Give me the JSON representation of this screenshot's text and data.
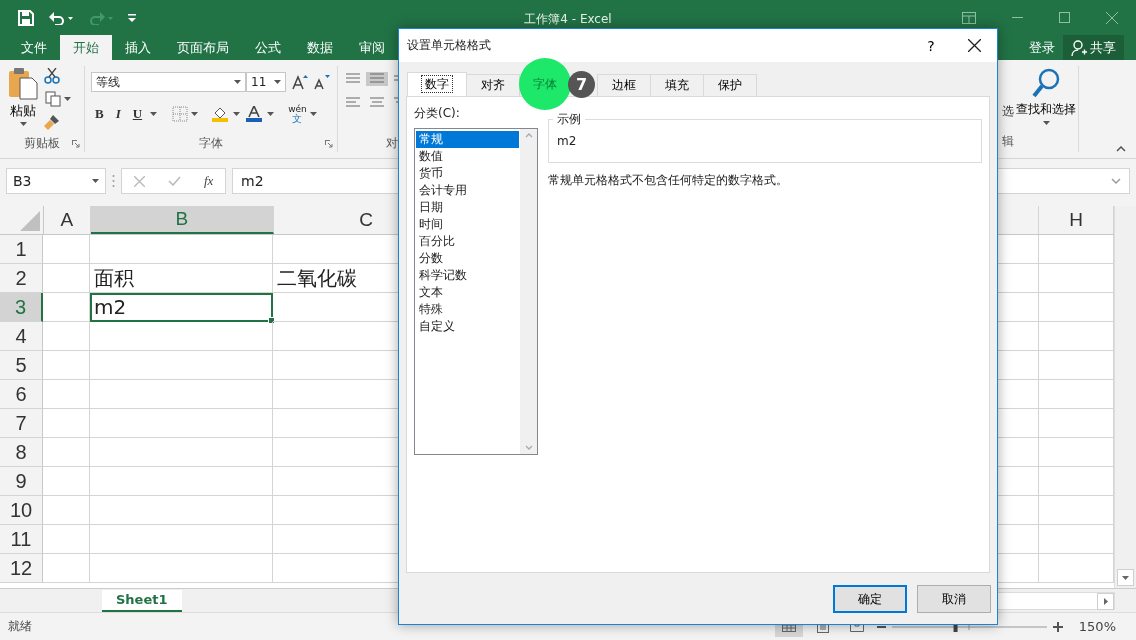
{
  "window": {
    "title": "工作簿4 - Excel"
  },
  "ribbon_tabs": [
    {
      "label": "文件",
      "selected": false
    },
    {
      "label": "开始",
      "selected": true
    },
    {
      "label": "插入",
      "selected": false
    },
    {
      "label": "页面布局",
      "selected": false
    },
    {
      "label": "公式",
      "selected": false
    },
    {
      "label": "数据",
      "selected": false
    },
    {
      "label": "审阅",
      "selected": false
    }
  ],
  "account": {
    "sign_in": "登录",
    "share": "共享"
  },
  "ribbon": {
    "paste": "粘贴",
    "clipboard_group": "剪贴板",
    "font_name": "等线",
    "font_size": "11",
    "phonetic": "wén",
    "phonetic_char": "文",
    "bold": "B",
    "italic": "I",
    "underline": "U",
    "font_group": "字体",
    "alignment_group_partial": "对",
    "sort_partial": "选",
    "find_select": "查找和选择",
    "editing_group_partial": "辑"
  },
  "formula_bar": {
    "name_box": "B3",
    "fx": "fx",
    "value": "m2"
  },
  "grid": {
    "columns": [
      {
        "label": "A",
        "selected": false
      },
      {
        "label": "B",
        "selected": true
      },
      {
        "label": "C",
        "selected": false
      },
      {
        "label": "H",
        "selected": false
      }
    ],
    "rows": [
      {
        "header": "1",
        "selected": false
      },
      {
        "header": "2",
        "selected": false,
        "column_b": "面积",
        "column_c": "二氧化碳"
      },
      {
        "header": "3",
        "selected": true,
        "column_b": "m2"
      },
      {
        "header": "4",
        "selected": false
      },
      {
        "header": "5",
        "selected": false
      },
      {
        "header": "6",
        "selected": false
      },
      {
        "header": "7",
        "selected": false
      },
      {
        "header": "8",
        "selected": false
      },
      {
        "header": "9",
        "selected": false
      },
      {
        "header": "10",
        "selected": false
      },
      {
        "header": "11",
        "selected": false
      },
      {
        "header": "12",
        "selected": false
      }
    ]
  },
  "sheet_tabs": [
    {
      "label": "Sheet1",
      "selected": true
    }
  ],
  "status_bar": {
    "status": "就绪",
    "zoom": "150%",
    "zoom_slider": {
      "level": 0.41
    }
  },
  "dialog": {
    "title": "设置单元格格式",
    "help": "?",
    "tabs": [
      {
        "label": "数字",
        "selected": true,
        "highlighted": false
      },
      {
        "label": "对齐",
        "selected": false,
        "highlighted": false
      },
      {
        "label": "字体",
        "selected": false,
        "highlighted": true
      },
      {
        "label": "边框",
        "selected": false,
        "highlighted": false
      },
      {
        "label": "填充",
        "selected": false,
        "highlighted": false
      },
      {
        "label": "保护",
        "selected": false,
        "highlighted": false
      }
    ],
    "category_label": "分类(C):",
    "categories": [
      {
        "label": "常规",
        "selected": true
      },
      {
        "label": "数值",
        "selected": false
      },
      {
        "label": "货币",
        "selected": false
      },
      {
        "label": "会计专用",
        "selected": false
      },
      {
        "label": "日期",
        "selected": false
      },
      {
        "label": "时间",
        "selected": false
      },
      {
        "label": "百分比",
        "selected": false
      },
      {
        "label": "分数",
        "selected": false
      },
      {
        "label": "科学记数",
        "selected": false
      },
      {
        "label": "文本",
        "selected": false
      },
      {
        "label": "特殊",
        "selected": false
      },
      {
        "label": "自定义",
        "selected": false
      }
    ],
    "sample_label": "示例",
    "sample_value": "m2",
    "description": "常规单元格格式不包含任何特定的数字格式。",
    "buttons": [
      {
        "label": "确定",
        "default": true
      },
      {
        "label": "取消",
        "default": false
      }
    ]
  },
  "tutorial_marker": {
    "step": "7"
  }
}
